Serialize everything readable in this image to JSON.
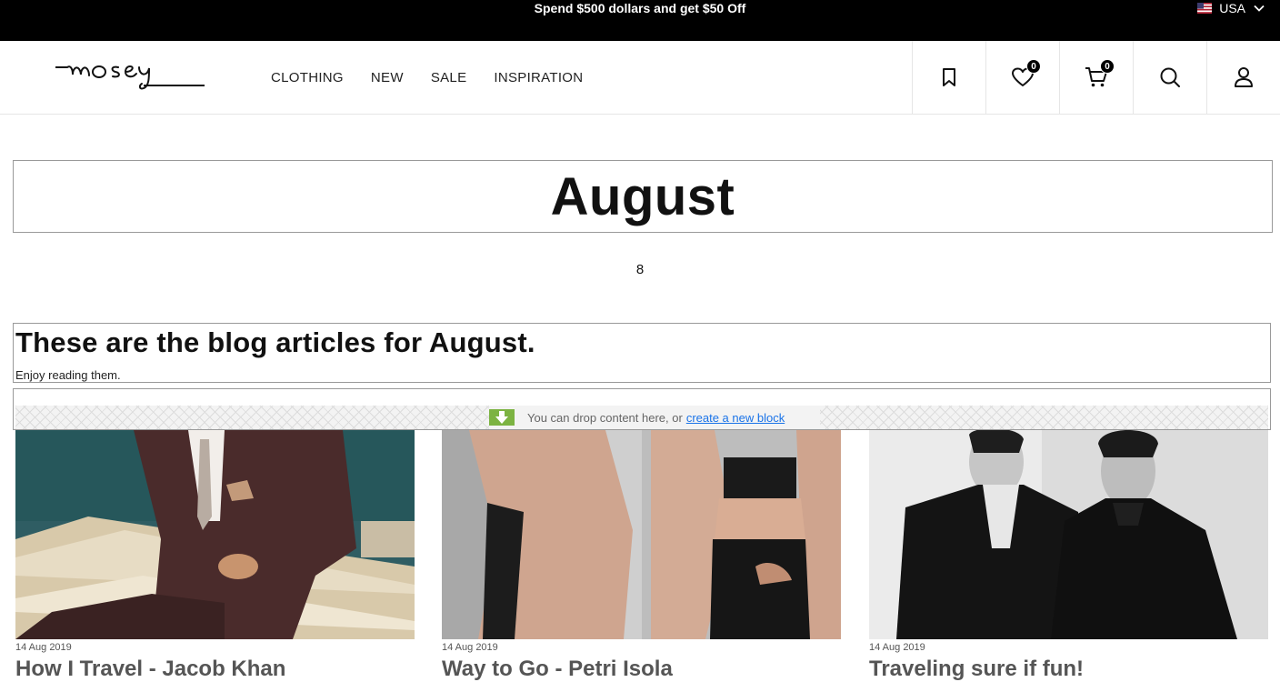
{
  "announcement": {
    "promo": "Spend $500 dollars and get $50 Off",
    "region": "USA"
  },
  "header": {
    "logo_text": "mosey",
    "nav": [
      "CLOTHING",
      "NEW",
      "SALE",
      "INSPIRATION"
    ],
    "wishlist_count": "0",
    "cart_count": "0"
  },
  "page": {
    "title": "August",
    "article_count": "8",
    "intro_heading": "These are the blog articles for August.",
    "intro_text": "Enjoy reading them."
  },
  "drop_zone": {
    "message": "You can drop content here, or",
    "link": "create a new block"
  },
  "articles": [
    {
      "date": "14 Aug 2019",
      "title": "How I Travel - Jacob Khan"
    },
    {
      "date": "14 Aug 2019",
      "title": "Way to Go - Petri Isola"
    },
    {
      "date": "14 Aug 2019",
      "title": "Traveling sure if fun!"
    }
  ],
  "colors": {
    "topbar_bg": "#000000",
    "accent_drop": "#7cb342",
    "link": "#1a73e8"
  }
}
